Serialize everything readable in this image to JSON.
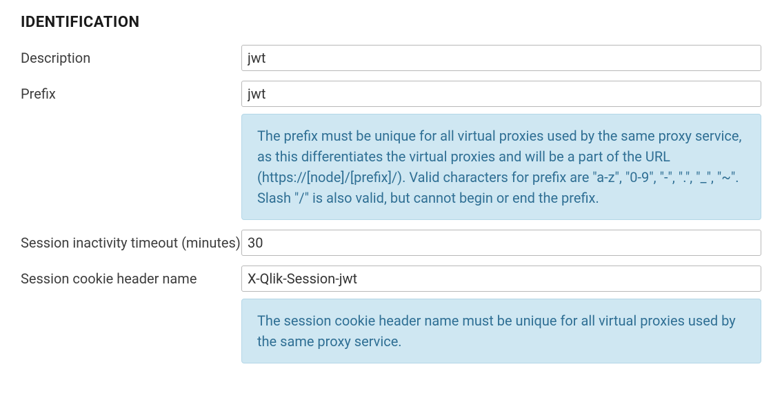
{
  "section": {
    "heading": "IDENTIFICATION"
  },
  "fields": {
    "description": {
      "label": "Description",
      "value": "jwt"
    },
    "prefix": {
      "label": "Prefix",
      "value": "jwt",
      "help": "The prefix must be unique for all virtual proxies used by the same proxy service, as this differentiates the virtual proxies and will be a part of the URL (https://[node]/[prefix]/). Valid characters for prefix are \"a-z\", \"0-9\", \"-\", \".\", \"_\", \"~\". Slash \"/\" is also valid, but cannot begin or end the prefix."
    },
    "session_timeout": {
      "label": "Session inactivity timeout (minutes)",
      "value": "30"
    },
    "session_cookie": {
      "label": "Session cookie header name",
      "value": "X-Qlik-Session-jwt",
      "help": "The session cookie header name must be unique for all virtual proxies used by the same proxy service."
    }
  }
}
